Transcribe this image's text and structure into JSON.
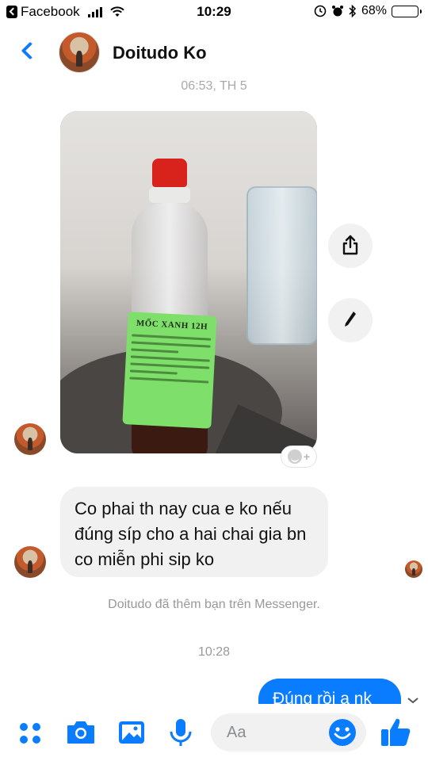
{
  "status_bar": {
    "back_app": "Facebook",
    "time": "10:29",
    "battery": "68%",
    "battery_level": 0.68,
    "icons": [
      "signal-icon",
      "wifi-icon",
      "location-lock-icon",
      "alarm-icon",
      "bluetooth-icon",
      "battery-icon"
    ]
  },
  "header": {
    "title": "Doitudo Ko",
    "back_icon": "chevron-left-icon"
  },
  "conversation": {
    "top_timestamp": "06:53, TH 5",
    "photo": {
      "label_title": "MỐC XANH 12H"
    },
    "incoming_text": "Co phai th nay cua e ko nếu đúng síp cho a hai chai gia bn co miễn phi sip ko",
    "system_notice": "Doitudo đã thêm bạn trên Messenger.",
    "second_timestamp": "10:28",
    "outgoing_text": "Đúng rồi a nk"
  },
  "composer": {
    "placeholder": "Aa",
    "icons": [
      "more-icon",
      "camera-icon",
      "gallery-icon",
      "microphone-icon",
      "emoji-icon",
      "like-icon"
    ]
  },
  "colors": {
    "accent": "#0a7cff",
    "bubble_incoming": "#f1f1f1",
    "muted_text": "#999999"
  }
}
